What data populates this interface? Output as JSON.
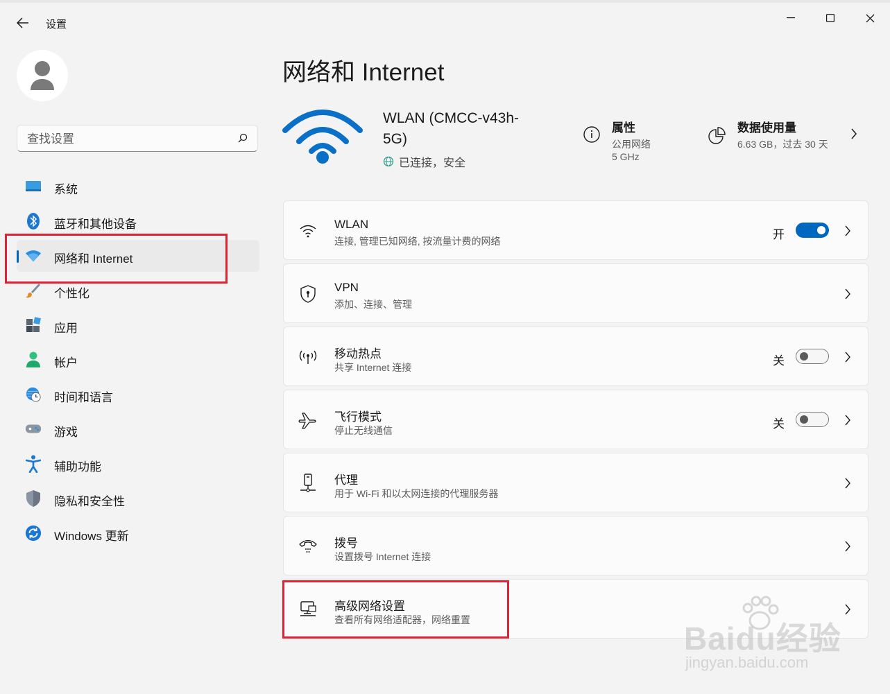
{
  "window": {
    "app_title": "设置",
    "controls": [
      "minimize",
      "maximize",
      "close"
    ]
  },
  "sidebar": {
    "search_placeholder": "查找设置",
    "items": [
      {
        "label": "系统",
        "icon": "system-monitor-icon",
        "active": false
      },
      {
        "label": "蓝牙和其他设备",
        "icon": "bluetooth-icon",
        "active": false
      },
      {
        "label": "网络和 Internet",
        "icon": "wifi-diamond-icon",
        "active": true
      },
      {
        "label": "个性化",
        "icon": "paintbrush-icon",
        "active": false
      },
      {
        "label": "应用",
        "icon": "apps-icon",
        "active": false
      },
      {
        "label": "帐户",
        "icon": "account-icon",
        "active": false
      },
      {
        "label": "时间和语言",
        "icon": "globe-clock-icon",
        "active": false
      },
      {
        "label": "游戏",
        "icon": "gamepad-icon",
        "active": false
      },
      {
        "label": "辅助功能",
        "icon": "accessibility-icon",
        "active": false
      },
      {
        "label": "隐私和安全性",
        "icon": "shield-icon",
        "active": false
      },
      {
        "label": "Windows 更新",
        "icon": "update-icon",
        "active": false
      }
    ]
  },
  "main": {
    "page_title": "网络和 Internet",
    "network": {
      "name": "WLAN (CMCC-v43h-5G)",
      "status": "已连接，安全"
    },
    "properties": {
      "title": "属性",
      "line1": "公用网络",
      "line2": "5 GHz"
    },
    "data_usage": {
      "title": "数据使用量",
      "subtitle": "6.63 GB，过去 30 天"
    },
    "cards": [
      {
        "title": "WLAN",
        "subtitle": "连接, 管理已知网络, 按流量计费的网络",
        "icon": "wifi-icon",
        "toggle": "开",
        "toggle_state": "on"
      },
      {
        "title": "VPN",
        "subtitle": "添加、连接、管理",
        "icon": "vpn-shield-icon"
      },
      {
        "title": "移动热点",
        "subtitle": "共享 Internet 连接",
        "icon": "hotspot-icon",
        "toggle": "关",
        "toggle_state": "off"
      },
      {
        "title": "飞行模式",
        "subtitle": "停止无线通信",
        "icon": "airplane-icon",
        "toggle": "关",
        "toggle_state": "off"
      },
      {
        "title": "代理",
        "subtitle": "用于 Wi-Fi 和以太网连接的代理服务器",
        "icon": "proxy-icon"
      },
      {
        "title": "拨号",
        "subtitle": "设置拨号 Internet 连接",
        "icon": "dialup-icon"
      },
      {
        "title": "高级网络设置",
        "subtitle": "查看所有网络适配器，网络重置",
        "icon": "network-adapter-icon"
      }
    ]
  },
  "watermark": {
    "brand": "Baidu经验",
    "url": "jingyan.baidu.com"
  },
  "colors": {
    "accent": "#0067c0",
    "highlight": "#e52131",
    "background": "#f3f3f3",
    "card": "#fbfbfb"
  }
}
